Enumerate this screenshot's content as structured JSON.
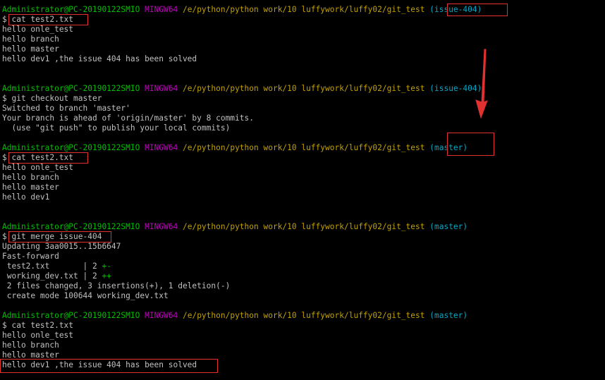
{
  "prompts": [
    {
      "user": "Administrator@PC-20190122SMIO",
      "sys": "MINGW64",
      "path": "/e/python/python work/10 luffywork/luffy02/git_test",
      "branch": "(issue-404)"
    },
    {
      "user": "Administrator@PC-20190122SMIO",
      "sys": "MINGW64",
      "path": "/e/python/python work/10 luffywork/luffy02/git_test",
      "branch": "(issue-404)"
    },
    {
      "user": "Administrator@PC-20190122SMIO",
      "sys": "MINGW64",
      "path": "/e/python/python work/10 luffywork/luffy02/git_test",
      "branch": "(master)"
    },
    {
      "user": "Administrator@PC-20190122SMIO",
      "sys": "MINGW64",
      "path": "/e/python/python work/10 luffywork/luffy02/git_test",
      "branch": "(master)"
    },
    {
      "user": "Administrator@PC-20190122SMIO",
      "sys": "MINGW64",
      "path": "/e/python/python work/10 luffywork/luffy02/git_test",
      "branch": "(master)"
    }
  ],
  "commands": [
    "$ cat test2.txt",
    "$ git checkout master",
    "$ cat test2.txt",
    "$ git merge issue-404",
    "$ cat test2.txt"
  ],
  "output1": [
    "hello onle_test",
    "hello branch",
    "hello master",
    "hello dev1 ,the issue 404 has been solved"
  ],
  "output2": [
    "Switched to branch 'master'",
    "Your branch is ahead of 'origin/master' by 8 commits.",
    "  (use \"git push\" to publish your local commits)"
  ],
  "output3": [
    "hello onle_test",
    "hello branch",
    "hello master",
    "hello dev1"
  ],
  "output4": {
    "updating": "Updating 3aa0015..15b6647",
    "fast_forward": "Fast-forward",
    "files": [
      {
        "name": " test2.txt       | 2 ",
        "diff": "+-"
      },
      {
        "name": " working_dev.txt | 2 ",
        "diff": "++"
      }
    ],
    "summary": " 2 files changed, 3 insertions(+), 1 deletion(-)",
    "create": " create mode 100644 working_dev.txt"
  },
  "output5": [
    "hello onle_test",
    "hello branch",
    "hello master",
    "hello dev1 ,the issue 404 has been solved"
  ],
  "colors": {
    "background": "#000000",
    "user": "#00c000",
    "system": "#c000c0",
    "path": "#c0a000",
    "branch": "#00a8c8",
    "text": "#c0c0c0",
    "highlight": "#e03030"
  }
}
